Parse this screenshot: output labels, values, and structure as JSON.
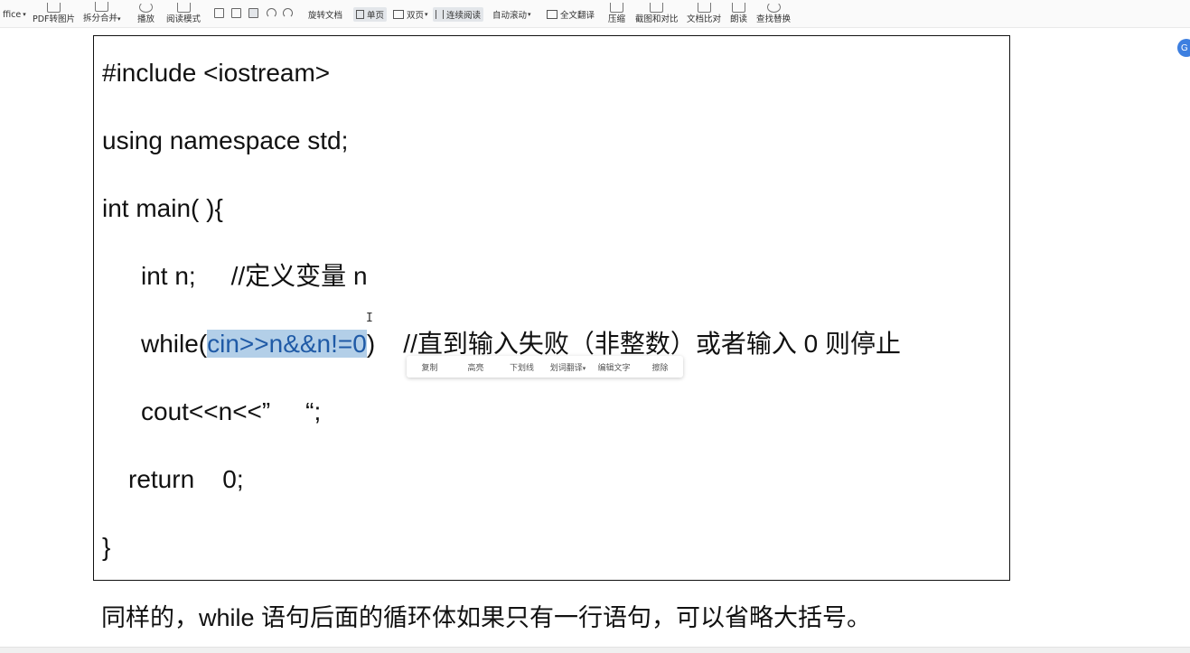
{
  "toolbar": {
    "app_fragment": "ffice",
    "items": {
      "pdf_to_image": "PDF转图片",
      "split_merge": "拆分合并",
      "play": "播放",
      "read_mode": "阅读模式",
      "rotate_doc": "旋转文档",
      "single_page": "单页",
      "double_page": "双页",
      "continuous_read": "连续阅读",
      "auto_scroll": "自动滚动",
      "full_translate": "全文翻译",
      "compress": "压缩",
      "screenshot_compare": "截图和对比",
      "doc_compare": "文档比对",
      "read_aloud": "朗读",
      "find_replace": "查找替换"
    }
  },
  "side_badge": "G",
  "code": {
    "line1": "#include <iostream>",
    "line2": "using namespace std;",
    "line3": "int main( ){",
    "line4": "int n;     //定义变量 n",
    "line5_pre": "while(",
    "line5_highlight": "cin>>n&&n!=0",
    "line5_post": ")    //直到输入失败（非整数）或者输入 0 则停止",
    "line6": "cout<<n<<”     “;",
    "line7": "return    0;",
    "line8": "}"
  },
  "popup": {
    "copy": "复制",
    "highlight": "高亮",
    "underline": "下划线",
    "translate": "划词翻译",
    "edit_text": "编辑文字",
    "erase": "擦除"
  },
  "cursor_glyph": "I",
  "caption": "同样的，while 语句后面的循环体如果只有一行语句，可以省略大括号。"
}
